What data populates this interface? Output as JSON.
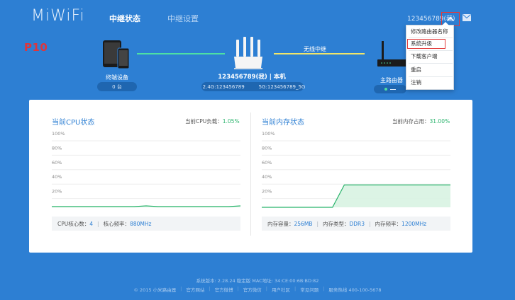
{
  "header": {
    "logo": "MiWiFi",
    "tabs": [
      {
        "label": "中继状态",
        "active": true
      },
      {
        "label": "中继设置",
        "active": false
      }
    ],
    "user_id": "123456789(我)",
    "icons": [
      "chevron-up-icon",
      "mail-icon"
    ]
  },
  "annotation": "P10",
  "topology": {
    "terminal_label": "终端设备",
    "terminal_count": "0 台",
    "router_label": "123456789(我) | 本机",
    "wifi_24": "2.4G:123456789",
    "wifi_5": "5G:123456789_5G",
    "relay_label": "无线中继",
    "main_router_label": "主路由器"
  },
  "dropdown": {
    "items": [
      {
        "label": "修改路由器名称",
        "highlighted": false
      },
      {
        "label": "系统升级",
        "highlighted": true
      },
      {
        "label": "下载客户端",
        "highlighted": false
      },
      {
        "label": "重启",
        "highlighted": false
      },
      {
        "label": "注销",
        "highlighted": false
      }
    ]
  },
  "cpu": {
    "title": "当前CPU状态",
    "metric_label": "当前CPU负载：",
    "metric_value": "1.05%",
    "info_cores_label": "CPU核心数：",
    "info_cores_value": "4",
    "info_freq_label": "核心频率：",
    "info_freq_value": "880MHz"
  },
  "mem": {
    "title": "当前内存状态",
    "metric_label": "当前内存占用：",
    "metric_value": "31.00%",
    "info_cap_label": "内存容量：",
    "info_cap_value": "256MB",
    "info_type_label": "内存类型：",
    "info_type_value": "DDR3",
    "info_freq_label": "内存频率：",
    "info_freq_value": "1200MHz"
  },
  "chart_data": [
    {
      "type": "area",
      "title": "当前CPU状态",
      "ylim": [
        0,
        100
      ],
      "yticks": [
        "100%",
        "80%",
        "60%",
        "40%",
        "20%"
      ],
      "values": [
        1,
        1,
        1,
        1,
        1,
        1,
        1,
        1,
        2,
        1,
        1,
        1,
        1,
        1,
        1,
        1,
        2
      ],
      "color": "#28b36b"
    },
    {
      "type": "area",
      "title": "当前内存状态",
      "ylim": [
        0,
        100
      ],
      "yticks": [
        "100%",
        "80%",
        "60%",
        "40%",
        "20%"
      ],
      "values": [
        0,
        0,
        0,
        0,
        0,
        0,
        0,
        31,
        31,
        31,
        31,
        31,
        31,
        31,
        31,
        31,
        31
      ],
      "color": "#28b36b"
    }
  ],
  "footer": {
    "version": "系统版本: 2.28.24 稳定版  MAC地址: 34:CE:00:6B:BD:82",
    "links": [
      "© 2015 小米路由器",
      "官方网站",
      "官方微博",
      "官方微信",
      "用户社区",
      "常见问题",
      "服务热线 400-100-5678"
    ]
  },
  "colors": {
    "background": "#2d7fd3",
    "accent_green": "#28b36b",
    "highlight_red": "#e23b3b"
  }
}
